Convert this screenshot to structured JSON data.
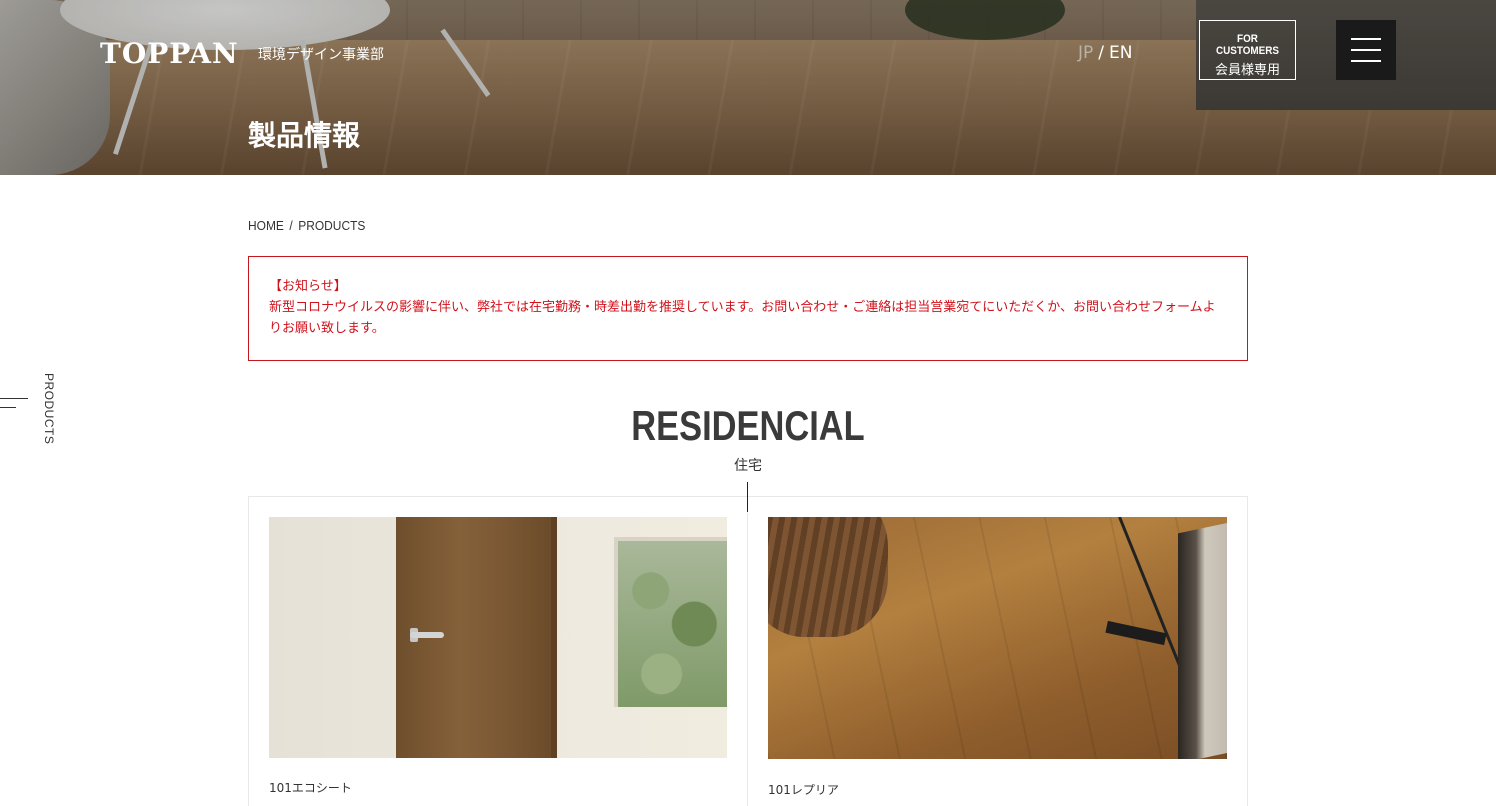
{
  "header": {
    "logo": "TOPPAN",
    "division": "環境デザイン事業部",
    "page_title": "製品情報",
    "lang_jp": "JP",
    "lang_sep": "/",
    "lang_en": "EN",
    "customer_button": {
      "en": "FOR CUSTOMERS",
      "ja": "会員様専用"
    }
  },
  "side_tab": {
    "label": "PRODUCTS"
  },
  "breadcrumb": {
    "home": "HOME",
    "separator": "/",
    "current": "PRODUCTS"
  },
  "notice": {
    "title": "【お知らせ】",
    "body": "新型コロナウイルスの影響に伴い、弊社では在宅勤務・時差出勤を推奨しています。お問い合わせ・ご連絡は担当営業宛てにいただくか、お問い合わせフォームよりお願い致します。",
    "color": "#d0121b"
  },
  "section": {
    "title": "RESIDENCIAL",
    "subtitle": "住宅"
  },
  "products": [
    {
      "name": "101エコシート",
      "image": "door-icon"
    },
    {
      "name": "101レプリア",
      "image": "wood-floor-icon"
    }
  ]
}
